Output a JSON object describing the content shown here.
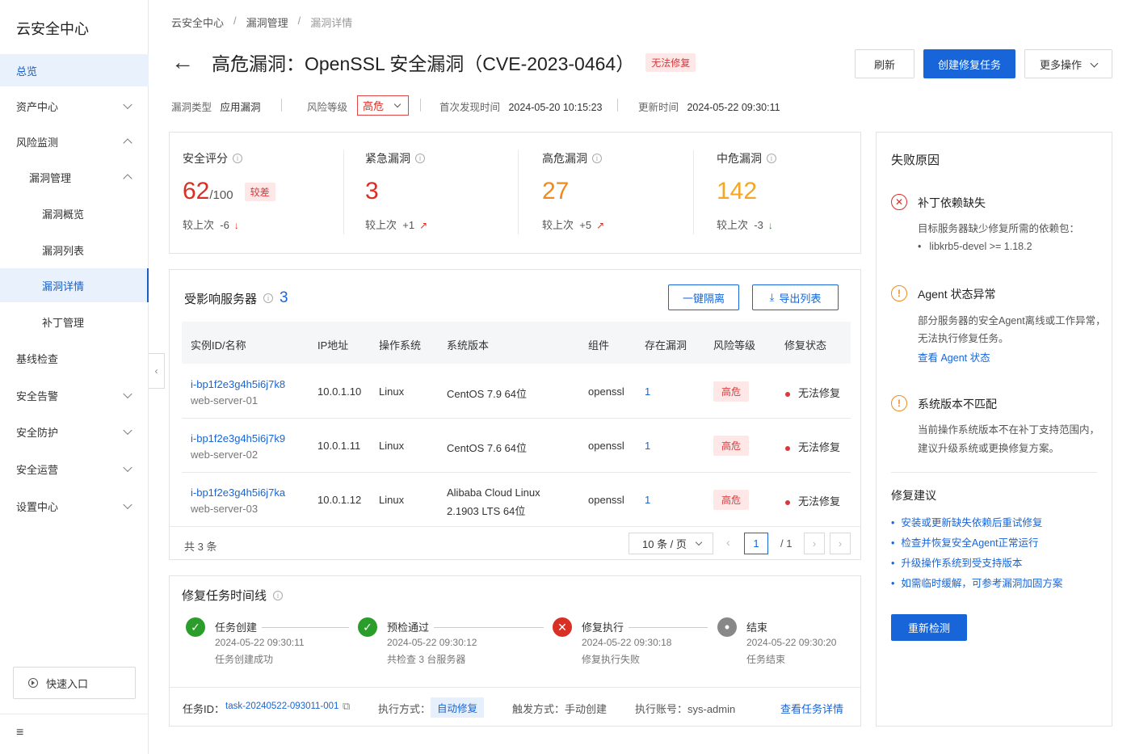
{
  "sidebar": {
    "brand": "云安全中心",
    "items": [
      {
        "label": "总览"
      },
      {
        "label": "资产中心"
      },
      {
        "label": "风险监测"
      },
      {
        "label": "漏洞管理"
      },
      {
        "label": "漏洞概览"
      },
      {
        "label": "漏洞列表"
      },
      {
        "label": "漏洞详情"
      },
      {
        "label": "补丁管理"
      },
      {
        "label": "基线检查"
      },
      {
        "label": "安全告警"
      },
      {
        "label": "安全防护"
      },
      {
        "label": "安全运营"
      },
      {
        "label": "设置中心"
      }
    ],
    "quick_entry": "快速入口",
    "collapse_glyph": "‹",
    "menu_glyph": "≡"
  },
  "breadcrumb": [
    "云安全中心",
    "漏洞管理",
    "漏洞详情"
  ],
  "breadcrumb_sep": "/",
  "header": {
    "back_glyph": "←",
    "title": "高危漏洞：OpenSSL 安全漏洞（CVE-2023-0464）",
    "status": "无法修复",
    "refresh": "刷新",
    "create_task": "创建修复任务",
    "more": "更多操作"
  },
  "meta": {
    "type_label": "漏洞类型",
    "type_value": "应用漏洞",
    "risk_label": "风险等级",
    "risk_value": "高危",
    "first_label": "首次发现时间",
    "first_value": "2024-05-20 10:15:23",
    "update_label": "更新时间",
    "update_value": "2024-05-22 09:30:11"
  },
  "stats": [
    {
      "label": "安全评分",
      "value": "62",
      "suffix": "/100",
      "tag": "较差",
      "delta_label": "较上次",
      "delta": "-6",
      "arrow": "↓",
      "color": "#d93026",
      "arrow_color": "#d93026"
    },
    {
      "label": "紧急漏洞",
      "value": "3",
      "delta_label": "较上次",
      "delta": "+1",
      "arrow": "↗",
      "color": "#d93026",
      "arrow_color": "#d93026"
    },
    {
      "label": "高危漏洞",
      "value": "27",
      "delta_label": "较上次",
      "delta": "+5",
      "arrow": "↗",
      "color": "#f08a1c",
      "arrow_color": "#d93026"
    },
    {
      "label": "中危漏洞",
      "value": "142",
      "delta_label": "较上次",
      "delta": "-3",
      "arrow": "↓",
      "color": "#f5a623",
      "arrow_color": "#2a9d2a"
    }
  ],
  "servers": {
    "title": "受影响服务器",
    "count": "3",
    "isolate": "一键隔离",
    "export": "导出列表",
    "columns": [
      "实例ID/名称",
      "IP地址",
      "操作系统",
      "系统版本",
      "组件",
      "存在漏洞",
      "风险等级",
      "修复状态"
    ],
    "rows": [
      {
        "id": "i-bp1f2e3g4h5i6j7k8",
        "name": "web-server-01",
        "ip": "10.0.1.10",
        "os": "Linux",
        "ver": "CentOS 7.9 64位",
        "ver2": "",
        "comp": "openssl",
        "vuln": "1",
        "risk": "高危",
        "status": "无法修复"
      },
      {
        "id": "i-bp1f2e3g4h5i6j7k9",
        "name": "web-server-02",
        "ip": "10.0.1.11",
        "os": "Linux",
        "ver": "CentOS 7.6 64位",
        "ver2": "",
        "comp": "openssl",
        "vuln": "1",
        "risk": "高危",
        "status": "无法修复"
      },
      {
        "id": "i-bp1f2e3g4h5i6j7ka",
        "name": "web-server-03",
        "ip": "10.0.1.12",
        "os": "Linux",
        "ver": "Alibaba Cloud Linux",
        "ver2": "2.1903 LTS 64位",
        "comp": "openssl",
        "vuln": "1",
        "risk": "高危",
        "status": "无法修复"
      }
    ],
    "total": "共 3 条",
    "page_size": "10 条 / 页",
    "page": "1",
    "pages": "/ 1"
  },
  "timeline": {
    "title": "修复任务时间线",
    "steps": [
      {
        "title": "任务创建",
        "time": "2024-05-22 09:30:11",
        "desc": "任务创建成功",
        "state": "success",
        "glyph": "✓"
      },
      {
        "title": "预检通过",
        "time": "2024-05-22 09:30:12",
        "desc": "共检查 3 台服务器",
        "state": "success",
        "glyph": "✓"
      },
      {
        "title": "修复执行",
        "time": "2024-05-22 09:30:18",
        "desc": "修复执行失败",
        "state": "error",
        "glyph": "✕"
      },
      {
        "title": "结束",
        "time": "2024-05-22 09:30:20",
        "desc": "任务结束",
        "state": "end",
        "glyph": "•"
      }
    ],
    "task_id_label": "任务ID：",
    "task_id": "task-20240522-093011-001",
    "exec_label": "执行方式：",
    "exec_value": "自动修复",
    "trigger": "触发方式：手动创建",
    "account": "执行账号：sys-admin",
    "detail_link": "查看任务详情"
  },
  "failure": {
    "title": "失败原因",
    "reasons": [
      {
        "title": "补丁依赖缺失",
        "text1": "目标服务器缺少修复所需的依赖包：",
        "text2": "libkrb5-devel >= 1.18.2"
      },
      {
        "title": "Agent 状态异常",
        "text1": "部分服务器的安全Agent离线或工作异常，",
        "text2": "无法执行修复任务。",
        "link": "查看 Agent 状态"
      },
      {
        "title": "系统版本不匹配",
        "text1": "当前操作系统版本不在补丁支持范围内，",
        "text2": "建议升级系统或更换修复方案。"
      }
    ],
    "suggest_title": "修复建议",
    "suggestions": [
      "安装或更新缺失依赖后重试修复",
      "检查并恢复安全Agent正常运行",
      "升级操作系统到受支持版本",
      "如需临时缓解，可参考漏洞加固方案"
    ],
    "recheck": "重新检测"
  },
  "colors": {
    "primary": "#1765d8",
    "danger": "#d93026",
    "success": "#2a9d2a",
    "warning": "#f08a1c"
  }
}
